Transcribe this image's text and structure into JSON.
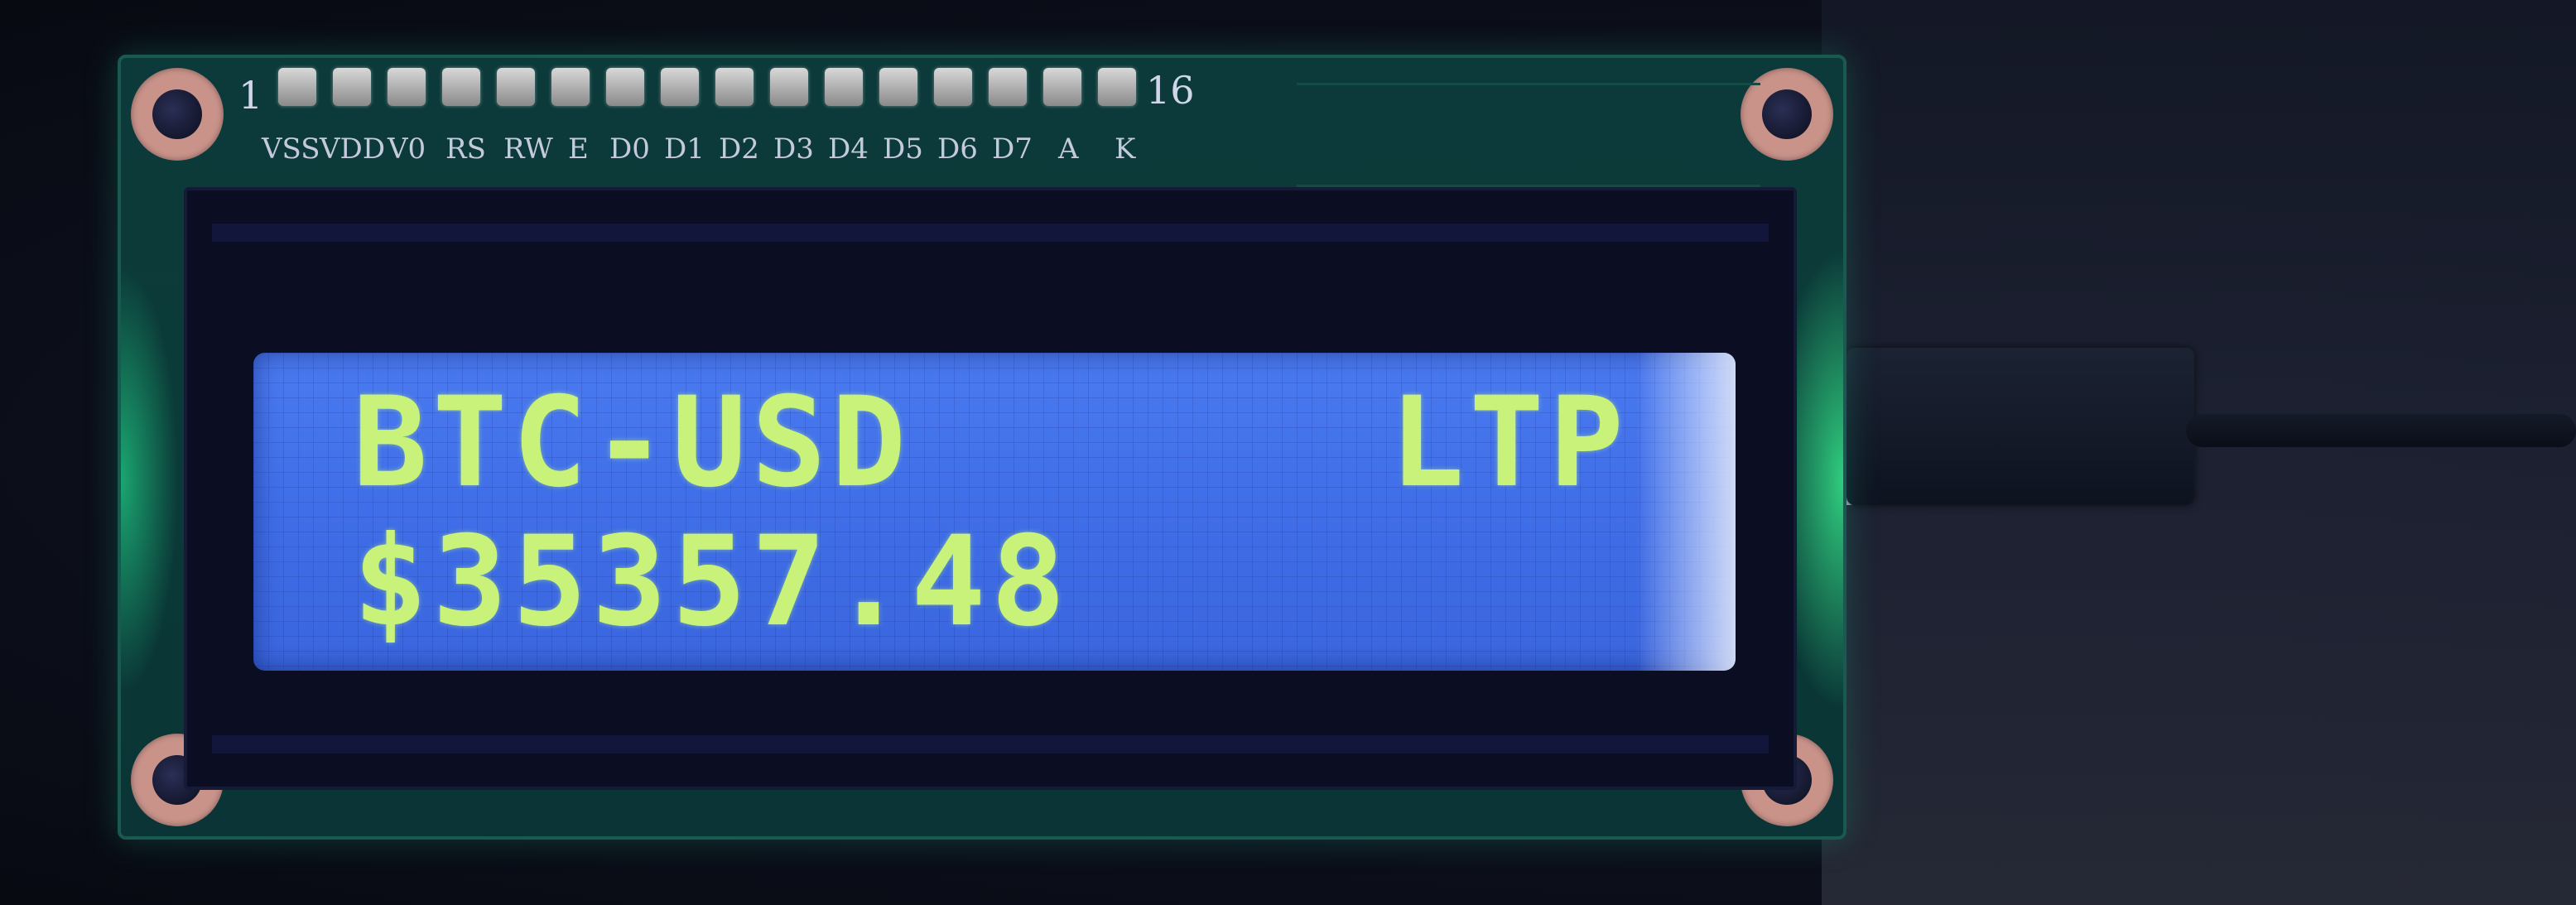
{
  "header": {
    "pin_first": "1",
    "pin_last": "16",
    "pin_labels": [
      "VSS",
      "VDD",
      "V0",
      "RS",
      "RW",
      "E",
      "D0",
      "D1",
      "D2",
      "D3",
      "D4",
      "D5",
      "D6",
      "D7",
      "A",
      "K"
    ]
  },
  "lcd": {
    "line1_left": "BTC-USD",
    "line1_right": "LTP",
    "line2": "$35357.48",
    "text_color": "#c9f27a",
    "backlight_color": "#4a7af0"
  },
  "board": {
    "pcb_color": "#0c3a3a",
    "glow_color": "#28ffa0"
  }
}
